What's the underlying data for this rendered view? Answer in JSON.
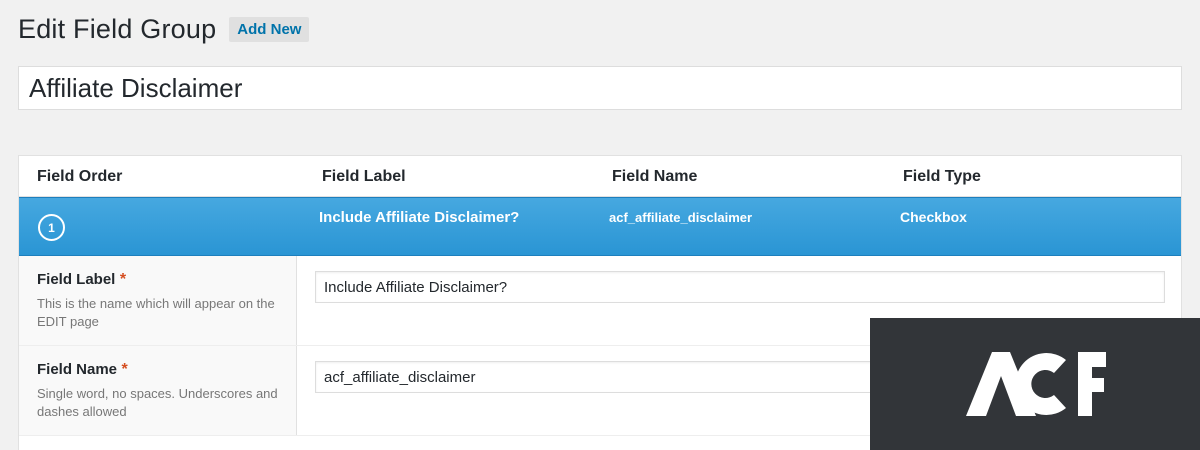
{
  "header": {
    "title": "Edit Field Group",
    "add_new_label": "Add New"
  },
  "group_title": {
    "value": "Affiliate Disclaimer"
  },
  "columns": [
    "Field Order",
    "Field Label",
    "Field Name",
    "Field Type"
  ],
  "field_row": {
    "order": "1",
    "label": "Include Affiliate Disclaimer?",
    "name": "acf_affiliate_disclaimer",
    "type": "Checkbox"
  },
  "settings": [
    {
      "name": "Field Label",
      "required": "*",
      "description": "This is the name which will appear on the EDIT page",
      "value": "Include Affiliate Disclaimer?"
    },
    {
      "name": "Field Name",
      "required": "*",
      "description": "Single word, no spaces. Underscores and dashes allowed",
      "value": "acf_affiliate_disclaimer"
    }
  ],
  "logo": {
    "text": "ACF"
  },
  "colors": {
    "accent_blue": "#2a95d4",
    "link_blue": "#0073aa",
    "required_red": "#d54e21",
    "logo_bg": "#323539"
  }
}
